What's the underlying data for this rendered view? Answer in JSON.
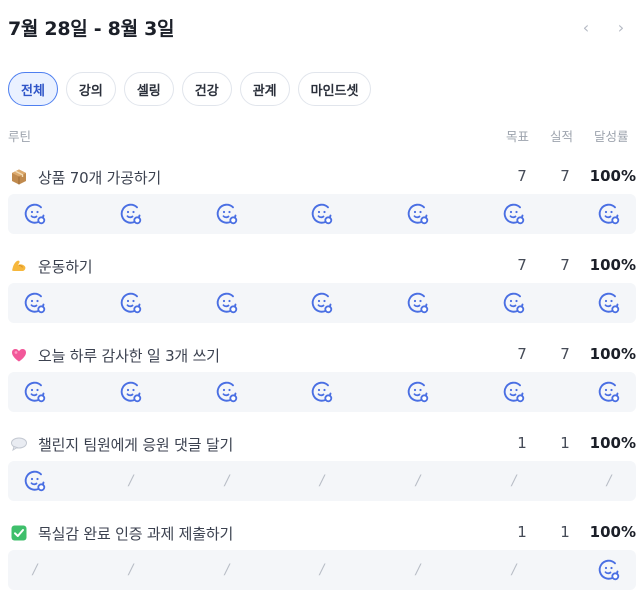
{
  "header": {
    "week_range": "7월 28일 - 8월 3일",
    "prev_label": "‹",
    "next_label": "›"
  },
  "tabs": [
    {
      "label": "전체",
      "active": true
    },
    {
      "label": "강의",
      "active": false
    },
    {
      "label": "셀링",
      "active": false
    },
    {
      "label": "건강",
      "active": false
    },
    {
      "label": "관계",
      "active": false
    },
    {
      "label": "마인드셋",
      "active": false
    }
  ],
  "columns": {
    "routine": "루틴",
    "goal": "목표",
    "actual": "실적",
    "rate": "달성률"
  },
  "colors": {
    "accent": "#4e7ff0",
    "checkin_icon": "#4a6fe3",
    "empty_slash": "#b9bec7",
    "strip_bg": "#f4f6f9"
  },
  "routines": [
    {
      "icon": "package-icon",
      "title": "상품 70개 가공하기",
      "goal": "7",
      "actual": "7",
      "rate": "100%",
      "days": [
        "done",
        "done",
        "done",
        "done",
        "done",
        "done",
        "done"
      ]
    },
    {
      "icon": "flexed-biceps-icon",
      "title": "운동하기",
      "goal": "7",
      "actual": "7",
      "rate": "100%",
      "days": [
        "done",
        "done",
        "done",
        "done",
        "done",
        "done",
        "done"
      ]
    },
    {
      "icon": "pink-heart-icon",
      "title": "오늘 하루 감사한 일 3개 쓰기",
      "goal": "7",
      "actual": "7",
      "rate": "100%",
      "days": [
        "done",
        "done",
        "done",
        "done",
        "done",
        "done",
        "done"
      ]
    },
    {
      "icon": "speech-bubble-icon",
      "title": "챌린지 팀원에게 응원 댓글 달기",
      "goal": "1",
      "actual": "1",
      "rate": "100%",
      "days": [
        "done",
        "empty",
        "empty",
        "empty",
        "empty",
        "empty",
        "empty"
      ]
    },
    {
      "icon": "check-mark-button-icon",
      "title": "목실감 완료 인증 과제 제출하기",
      "goal": "1",
      "actual": "1",
      "rate": "100%",
      "days": [
        "empty",
        "empty",
        "empty",
        "empty",
        "empty",
        "empty",
        "done"
      ]
    }
  ],
  "empty_mark": "/"
}
